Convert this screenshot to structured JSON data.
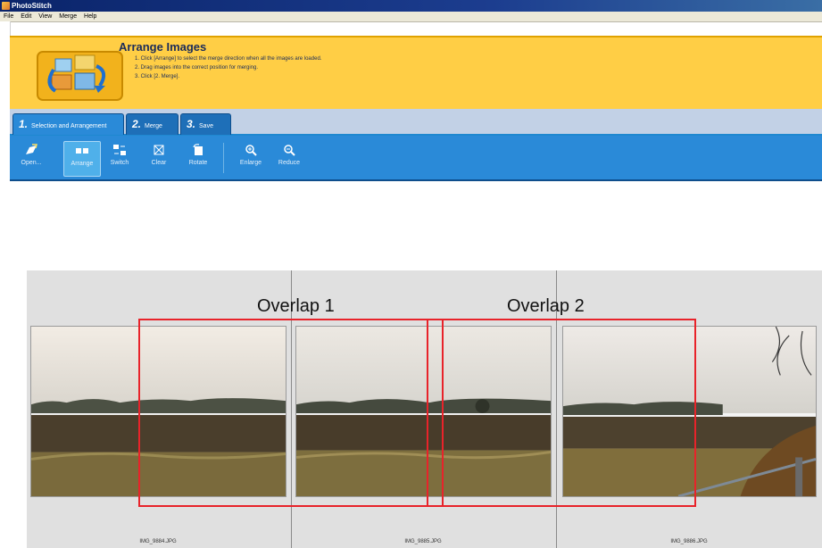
{
  "window": {
    "title": "PhotoStitch"
  },
  "menu": [
    "File",
    "Edit",
    "View",
    "Merge",
    "Help"
  ],
  "header": {
    "title": "Arrange Images",
    "instructions": [
      "1. Click [Arrange] to select the merge direction when all the images are loaded.",
      "2. Drag images into the correct position for merging.",
      "3. Click [2. Merge]."
    ]
  },
  "tabs": [
    {
      "num": "1.",
      "label": "Selection and Arrangement"
    },
    {
      "num": "2.",
      "label": "Merge"
    },
    {
      "num": "3.",
      "label": "Save"
    }
  ],
  "toolbar": {
    "open": "Open...",
    "arrange": "Arrange",
    "switch": "Switch",
    "clear": "Clear",
    "rotate": "Rotate",
    "enlarge": "Enlarge",
    "reduce": "Reduce",
    "active_tool": "Arrange"
  },
  "images": [
    {
      "file": "IMG_9884.JPG"
    },
    {
      "file": "IMG_9885.JPG"
    },
    {
      "file": "IMG_9886.JPG"
    }
  ],
  "overlaps": [
    {
      "label": "Overlap 1"
    },
    {
      "label": "Overlap 2"
    }
  ],
  "colors": {
    "header_bg": "#ffce45",
    "toolbar_bg": "#2a8ad8",
    "overlap_box": "#e8232a"
  }
}
